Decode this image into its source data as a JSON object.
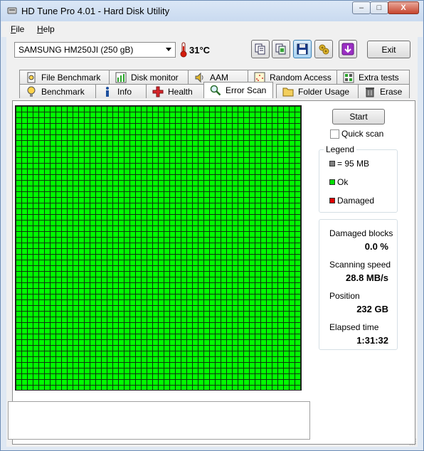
{
  "window": {
    "title": "HD Tune Pro 4.01 - Hard Disk Utility",
    "controls": {
      "minimize": "–",
      "maximize": "□",
      "close": "X"
    }
  },
  "menu": [
    {
      "accel": "F",
      "rest": "ile"
    },
    {
      "accel": "H",
      "rest": "elp"
    }
  ],
  "toolbar": {
    "drive": "SAMSUNG HM250JI (250 gB)",
    "temperature": "31°C",
    "icons": [
      "copy-text-icon",
      "copy-screenshot-icon",
      "save-icon",
      "options-icon",
      "download-icon"
    ],
    "exit_label": "Exit"
  },
  "tabs_top": [
    {
      "label": "File Benchmark",
      "icon": "file-benchmark-icon"
    },
    {
      "label": "Disk monitor",
      "icon": "disk-monitor-icon"
    },
    {
      "label": "AAM",
      "icon": "speaker-icon"
    },
    {
      "label": "Random Access",
      "icon": "random-access-icon"
    },
    {
      "label": "Extra tests",
      "icon": "extra-tests-icon"
    }
  ],
  "tabs_bottom": [
    {
      "label": "Benchmark",
      "icon": "benchmark-icon"
    },
    {
      "label": "Info",
      "icon": "info-icon"
    },
    {
      "label": "Health",
      "icon": "health-cross-icon"
    },
    {
      "label": "Error Scan",
      "icon": "magnifier-icon",
      "active": true
    },
    {
      "label": "Folder Usage",
      "icon": "folder-icon"
    },
    {
      "label": "Erase",
      "icon": "trash-icon"
    }
  ],
  "error_scan": {
    "start_label": "Start",
    "quick_scan_label": "Quick scan",
    "quick_scan_checked": false,
    "scan_map_status": "Ok",
    "legend": {
      "title": "Legend",
      "items": [
        {
          "label": "= 95 MB",
          "color": "#808080"
        },
        {
          "label": "Ok",
          "color": "#00e000"
        },
        {
          "label": "Damaged",
          "color": "#e00000"
        }
      ]
    },
    "stats": {
      "damaged_blocks_label": "Damaged blocks",
      "damaged_blocks_value": "0.0 %",
      "scanning_speed_label": "Scanning speed",
      "scanning_speed_value": "28.8 MB/s",
      "position_label": "Position",
      "position_value": "232 GB",
      "elapsed_label": "Elapsed time",
      "elapsed_value": "1:31:32"
    }
  },
  "colors": {
    "ok_block": "#00ff00",
    "grid_line": "#0f2f0f"
  }
}
